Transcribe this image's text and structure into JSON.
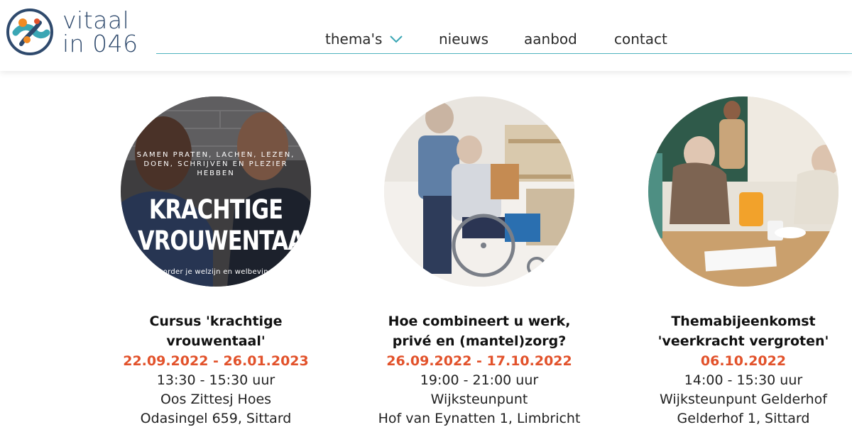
{
  "brand": {
    "line1": "vitaal",
    "line2": "in 046",
    "colors": {
      "navy": "#2f4a6d",
      "teal": "#3aa6b4",
      "orange": "#f08a24",
      "accent": "#e2522b"
    }
  },
  "nav": {
    "items": [
      {
        "label": "thema's",
        "has_dropdown": true
      },
      {
        "label": "nieuws"
      },
      {
        "label": "aanbod"
      },
      {
        "label": "contact"
      }
    ]
  },
  "cards": [
    {
      "image_overlay": {
        "small": "SAMEN PRATEN, LACHEN, LEZEN, DOEN, SCHRIJVEN EN PLEZIER HEBBEN",
        "big1": "KRACHTIGE",
        "big2": "VROUWENTAAL",
        "foot": "bevorder je welzijn en welbevinden"
      },
      "title1": "Cursus 'krachtige",
      "title2": "vrouwentaal'",
      "date": "22.09.2022 - 26.01.2023",
      "time": "13:30 - 15:30 uur",
      "place": "Oos Zittesj Hoes",
      "address": "Odasingel 659, Sittard"
    },
    {
      "title1": "Hoe combineert u werk,",
      "title2": "privé en (mantel)zorg?",
      "date": "26.09.2022 - 17.10.2022",
      "time": "19:00 - 21:00 uur",
      "place": "Wijksteunpunt",
      "address": "Hof van Eynatten 1, Limbricht"
    },
    {
      "title1": "Themabijeenkomst",
      "title2": "'veerkracht vergroten'",
      "date": "06.10.2022",
      "time": "14:00 - 15:30 uur",
      "place": "Wijksteunpunt Gelderhof",
      "address": "Gelderhof 1, Sittard"
    }
  ]
}
